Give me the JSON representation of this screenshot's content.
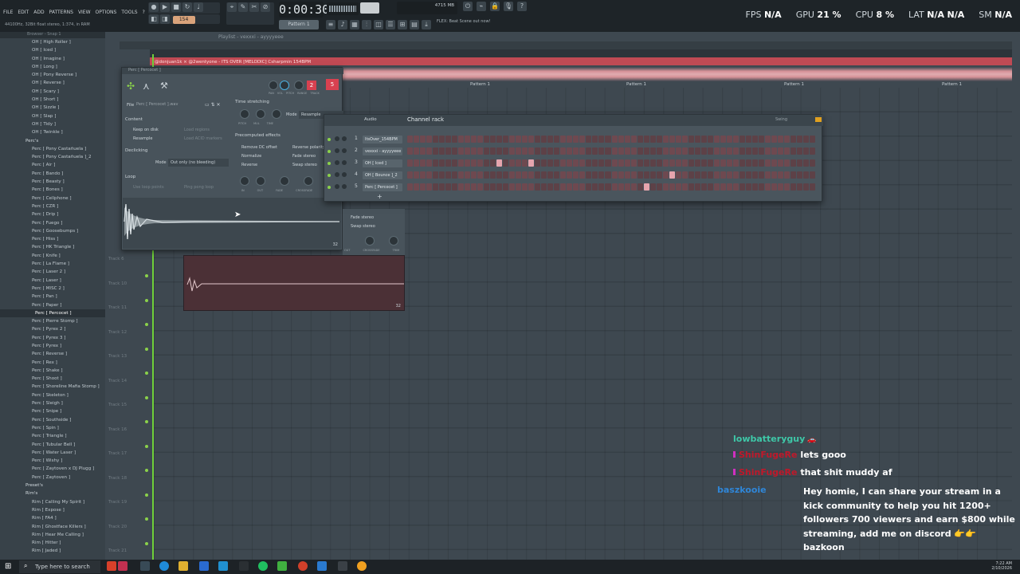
{
  "menu": [
    "FILE",
    "EDIT",
    "ADD",
    "PATTERNS",
    "VIEW",
    "OPTIONS",
    "TOOLS",
    "?"
  ],
  "audio_info": "44100Hz, 32Bit float stereo, 1:374, in RAM",
  "clock": "0:00:30",
  "memory": "4715 MB",
  "hint_text": "FLEX: Beat Scene out now!",
  "pattern_selector": "Pattern 1",
  "stats": {
    "fps_label": "FPS",
    "fps": "N/A",
    "gpu_label": "GPU",
    "gpu": "21 %",
    "cpu_label": "CPU",
    "cpu": "8 %",
    "lat_label": "LAT",
    "lat1": "N/A",
    "lat2": "N/A",
    "sm_label": "SM",
    "sm": "N/A"
  },
  "playlist": {
    "title": "Playlist - vexxxi - ayyyyeee",
    "audio_clip": "@donjuan1k × @2wentyone - ITS OVER [MELODIC] Csharpmin 154BPM",
    "pattern_label": "Pattern 1",
    "tracks": [
      "Track 6",
      "Track 10",
      "Track 11",
      "Track 12",
      "Track 13",
      "Track 14",
      "Track 15",
      "Track 16",
      "Track 17",
      "Track 18",
      "Track 19",
      "Track 20",
      "Track 21"
    ]
  },
  "browser": {
    "header": "Browser - Snap 1",
    "items": [
      {
        "label": "OH [ High Roller ]",
        "type": "item"
      },
      {
        "label": "OH [ Iced ]",
        "type": "item"
      },
      {
        "label": "OH [ Imagine ]",
        "type": "item"
      },
      {
        "label": "OH [ Long ]",
        "type": "item"
      },
      {
        "label": "OH [ Pony Reverse ]",
        "type": "item"
      },
      {
        "label": "OH [ Reverse ]",
        "type": "item"
      },
      {
        "label": "OH [ Scary ]",
        "type": "item"
      },
      {
        "label": "OH [ Short ]",
        "type": "item"
      },
      {
        "label": "OH [ Sizzle ]",
        "type": "item"
      },
      {
        "label": "OH [ Slap ]",
        "type": "item"
      },
      {
        "label": "OH [ Tidy ]",
        "type": "item"
      },
      {
        "label": "OH [ Twinkle ]",
        "type": "item"
      },
      {
        "label": "Perc's",
        "type": "folder"
      },
      {
        "label": "Perc [ Pony Castañuela ]",
        "type": "item"
      },
      {
        "label": "Perc [ Pony Castañuela ]_2",
        "type": "item"
      },
      {
        "label": "Perc [ Air ]",
        "type": "item"
      },
      {
        "label": "Perc [ Bando ]",
        "type": "item"
      },
      {
        "label": "Perc [ Beasty ]",
        "type": "item"
      },
      {
        "label": "Perc [ Bones ]",
        "type": "item"
      },
      {
        "label": "Perc [ Cellphone ]",
        "type": "item"
      },
      {
        "label": "Perc [ CZR ]",
        "type": "item"
      },
      {
        "label": "Perc [ Drip ]",
        "type": "item"
      },
      {
        "label": "Perc [ Fuego ]",
        "type": "item"
      },
      {
        "label": "Perc [ Goosebumps ]",
        "type": "item"
      },
      {
        "label": "Perc [ Hiss ]",
        "type": "item"
      },
      {
        "label": "Perc [ HK Triangle ]",
        "type": "item"
      },
      {
        "label": "Perc [ Knife ]",
        "type": "item"
      },
      {
        "label": "Perc [ La Flame ]",
        "type": "item"
      },
      {
        "label": "Perc [ Laser 2 ]",
        "type": "item"
      },
      {
        "label": "Perc [ Laser ]",
        "type": "item"
      },
      {
        "label": "Perc [ MISC 2 ]",
        "type": "item"
      },
      {
        "label": "Perc [ Pan ]",
        "type": "item"
      },
      {
        "label": "Perc [ Paper ]",
        "type": "item"
      },
      {
        "label": "Perc [ Percocet ]",
        "type": "sel"
      },
      {
        "label": "Perc [ Pierre Stomp ]",
        "type": "item"
      },
      {
        "label": "Perc [ Pyrex 2 ]",
        "type": "item"
      },
      {
        "label": "Perc [ Pyrex 3 ]",
        "type": "item"
      },
      {
        "label": "Perc [ Pyrex ]",
        "type": "item"
      },
      {
        "label": "Perc [ Reverse ]",
        "type": "item"
      },
      {
        "label": "Perc [ Rex ]",
        "type": "item"
      },
      {
        "label": "Perc [ Shake ]",
        "type": "item"
      },
      {
        "label": "Perc [ Shoot ]",
        "type": "item"
      },
      {
        "label": "Perc [ Shoreline Mafia Stomp ]",
        "type": "item"
      },
      {
        "label": "Perc [ Skeleton ]",
        "type": "item"
      },
      {
        "label": "Perc [ Sleigh ]",
        "type": "item"
      },
      {
        "label": "Perc [ Snipe ]",
        "type": "item"
      },
      {
        "label": "Perc [ Southside ]",
        "type": "item"
      },
      {
        "label": "Perc [ Spin ]",
        "type": "item"
      },
      {
        "label": "Perc [ Triangle ]",
        "type": "item"
      },
      {
        "label": "Perc [ Tubular Bell ]",
        "type": "item"
      },
      {
        "label": "Perc [ Water Laser ]",
        "type": "item"
      },
      {
        "label": "Perc [ Wishy ]",
        "type": "item"
      },
      {
        "label": "Perc [ Zaytoven x DJ Plugg ]",
        "type": "item"
      },
      {
        "label": "Perc [ Zaytoven ]",
        "type": "item"
      },
      {
        "label": "Preset's",
        "type": "folder"
      },
      {
        "label": "Rim's",
        "type": "folder"
      },
      {
        "label": "Rim [ Calling My Spirit ]",
        "type": "item"
      },
      {
        "label": "Rim [ Expose ]",
        "type": "item"
      },
      {
        "label": "Rim [ FA4 ]",
        "type": "item"
      },
      {
        "label": "Rim [ Ghostface Killers ]",
        "type": "item"
      },
      {
        "label": "Rim [ Hear Me Calling ]",
        "type": "item"
      },
      {
        "label": "Rim [ Hitter ]",
        "type": "item"
      },
      {
        "label": "Rim [ Jaded ]",
        "type": "item"
      }
    ]
  },
  "sampler": {
    "title": "Perc [ Percocet ]",
    "file_label": "File",
    "file_name": "Perc [ Percocet ].wav",
    "content": "Content",
    "keep_on_disk": "Keep on disk",
    "resample": "Resample",
    "load_regions": "Load regions",
    "load_acid": "Load ACID markers",
    "declicking": "Declicking",
    "mode_label": "Mode",
    "mode_value": "Out only (no bleeding)",
    "loop": "Loop",
    "use_loop_points": "Use loop points",
    "ping_pong": "Ping pong loop",
    "time_stretching": "Time stretching",
    "ts_mode_label": "Mode",
    "ts_mode_value": "Resample",
    "ts_knobs": [
      "PITCH",
      "MUL",
      "TIME"
    ],
    "precomputed": "Precomputed effects",
    "effects": [
      "Remove DC offset",
      "Normalize",
      "Reverse"
    ],
    "effects_right": [
      "Reverse polarity",
      "Fade stereo",
      "Swap stereo"
    ],
    "bottom_knobs": [
      "IN",
      "OUT",
      "FADE",
      "CROSSFADE"
    ],
    "top_knobs": [
      "PAN",
      "VOL",
      "PITCH",
      "RANGE",
      "TRACK"
    ],
    "track_num": "5",
    "num_2": "2",
    "wave_zoom": "32",
    "right_effects": [
      "Fade stereo",
      "Swap stereo"
    ],
    "right_knobs": [
      "OUT",
      "CROSSFADE",
      "TRIM"
    ]
  },
  "rack": {
    "title": "Channel rack",
    "filter": "Audio",
    "swing": "Swing",
    "add": "+",
    "channels": [
      {
        "num": "1",
        "name": "ItsOver_154BPM",
        "on": []
      },
      {
        "num": "2",
        "name": "vexxxi - ayyyyeee",
        "on": []
      },
      {
        "num": "3",
        "name": "OH [ Iced ]",
        "on": [
          14,
          19
        ]
      },
      {
        "num": "4",
        "name": "OH [ Bounce ]_2",
        "on": [
          41
        ]
      },
      {
        "num": "5",
        "name": "Perc [ Percocet ]",
        "on": [
          37
        ]
      }
    ]
  },
  "darkbox": {
    "zoom": "32"
  },
  "chat": [
    {
      "user": "lowbatteryguy",
      "color": "#3ec8a8",
      "msg": ""
    },
    {
      "user": "ShinFugeRe",
      "color": "#c0182a",
      "msg": "lets gooo"
    },
    {
      "user": "ShinFugeRe",
      "color": "#c0182a",
      "msg": "that shit muddy af"
    },
    {
      "user": "baszkooie",
      "color": "#2f86d8",
      "msg": "Hey homie, I can share your stream in a kick community to help you hit 1200+ followers 700 viewers and earn $800 while streaming, add me on discord 👉👉 bazkoon"
    }
  ],
  "taskbar": {
    "search_placeholder": "Type here to search",
    "time": "7:22 AM",
    "date": "2/10/2026"
  }
}
